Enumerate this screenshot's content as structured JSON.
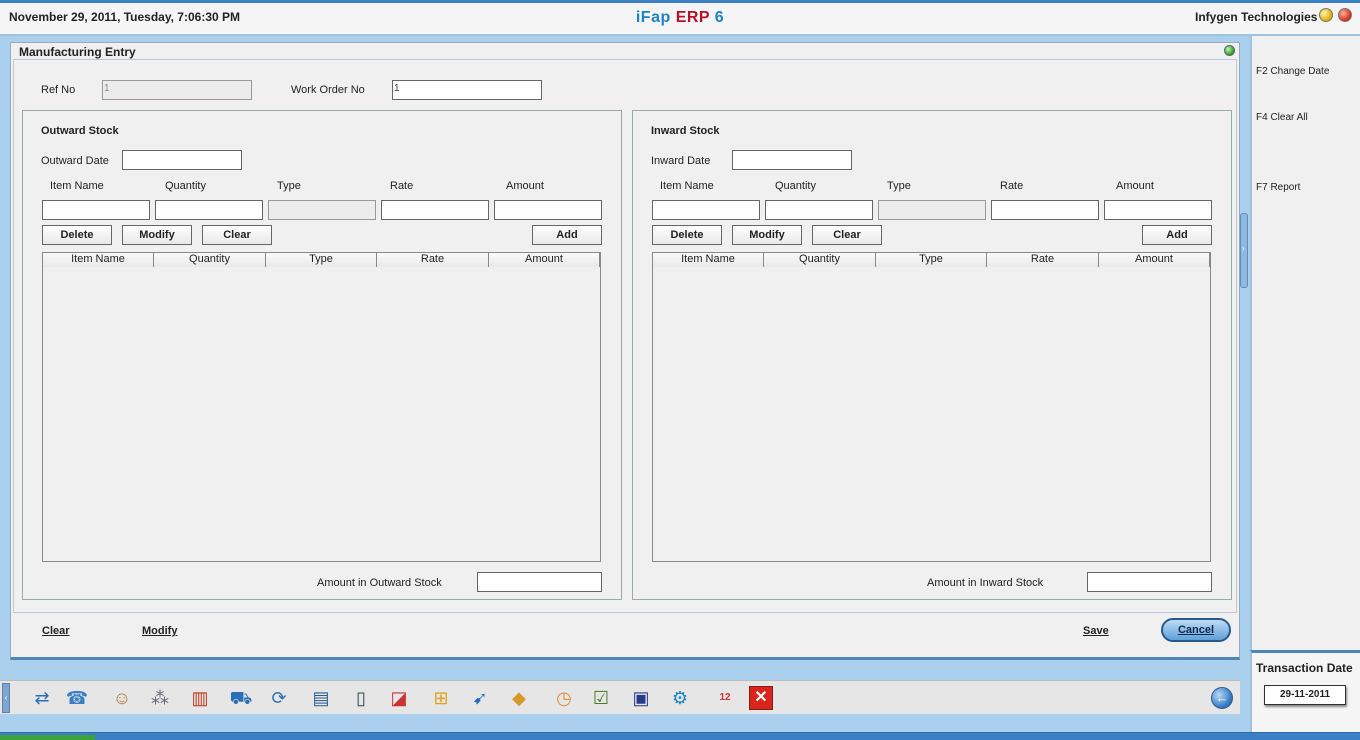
{
  "header": {
    "datetime": "November  29, 2011, Tuesday, 7:06:30 PM",
    "brand_part1": "iFap",
    "brand_part2": "ERP",
    "brand_part3": "6",
    "company": "Infygen Technologies"
  },
  "window": {
    "title": "Manufacturing Entry"
  },
  "form": {
    "ref_no_label": "Ref No",
    "ref_no_value": "1",
    "work_order_label": "Work Order No",
    "work_order_value": "1"
  },
  "outward": {
    "title": "Outward Stock",
    "date_label": "Outward Date",
    "date_value": "",
    "columns": [
      "Item Name",
      "Quantity",
      "Type",
      "Rate",
      "Amount"
    ],
    "buttons": {
      "delete": "Delete",
      "modify": "Modify",
      "clear": "Clear",
      "add": "Add"
    },
    "table_columns": [
      "Item Name",
      "Quantity",
      "Type",
      "Rate",
      "Amount"
    ],
    "amount_label": "Amount in Outward Stock",
    "amount_value": ""
  },
  "inward": {
    "title": "Inward Stock",
    "date_label": "Inward Date",
    "date_value": "",
    "columns": [
      "Item Name",
      "Quantity",
      "Type",
      "Rate",
      "Amount"
    ],
    "buttons": {
      "delete": "Delete",
      "modify": "Modify",
      "clear": "Clear",
      "add": "Add"
    },
    "table_columns": [
      "Item Name",
      "Quantity",
      "Type",
      "Rate",
      "Amount"
    ],
    "amount_label": "Amount in Inward Stock",
    "amount_value": ""
  },
  "footer": {
    "clear": "Clear",
    "modify": "Modify",
    "save": "Save",
    "cancel": "Cancel"
  },
  "shortcuts": [
    "F2 Change Date",
    "F4 Clear All",
    "F7 Report"
  ],
  "transaction": {
    "title": "Transaction Date",
    "date": "29-11-2011"
  },
  "taskbar": {
    "icons": [
      "transfer-icon",
      "user-support-icon",
      "staff-icon",
      "settings-dots-icon",
      "books-icon",
      "shopping-cart-icon",
      "sync-icon",
      "window-icon",
      "document-icon",
      "chart-icon",
      "hierarchy-icon",
      "arrows-icon",
      "package-icon",
      "clock-icon",
      "checklist-icon",
      "save-disk-icon",
      "gear-icon",
      "calendar-icon",
      "exit-icon"
    ],
    "calendar_day": "12",
    "back_icon": "back-arrow-icon"
  },
  "colors": {
    "brand_blue": "#1e83c6",
    "brand_red": "#b5122a",
    "accent": "#3b7fc4"
  }
}
